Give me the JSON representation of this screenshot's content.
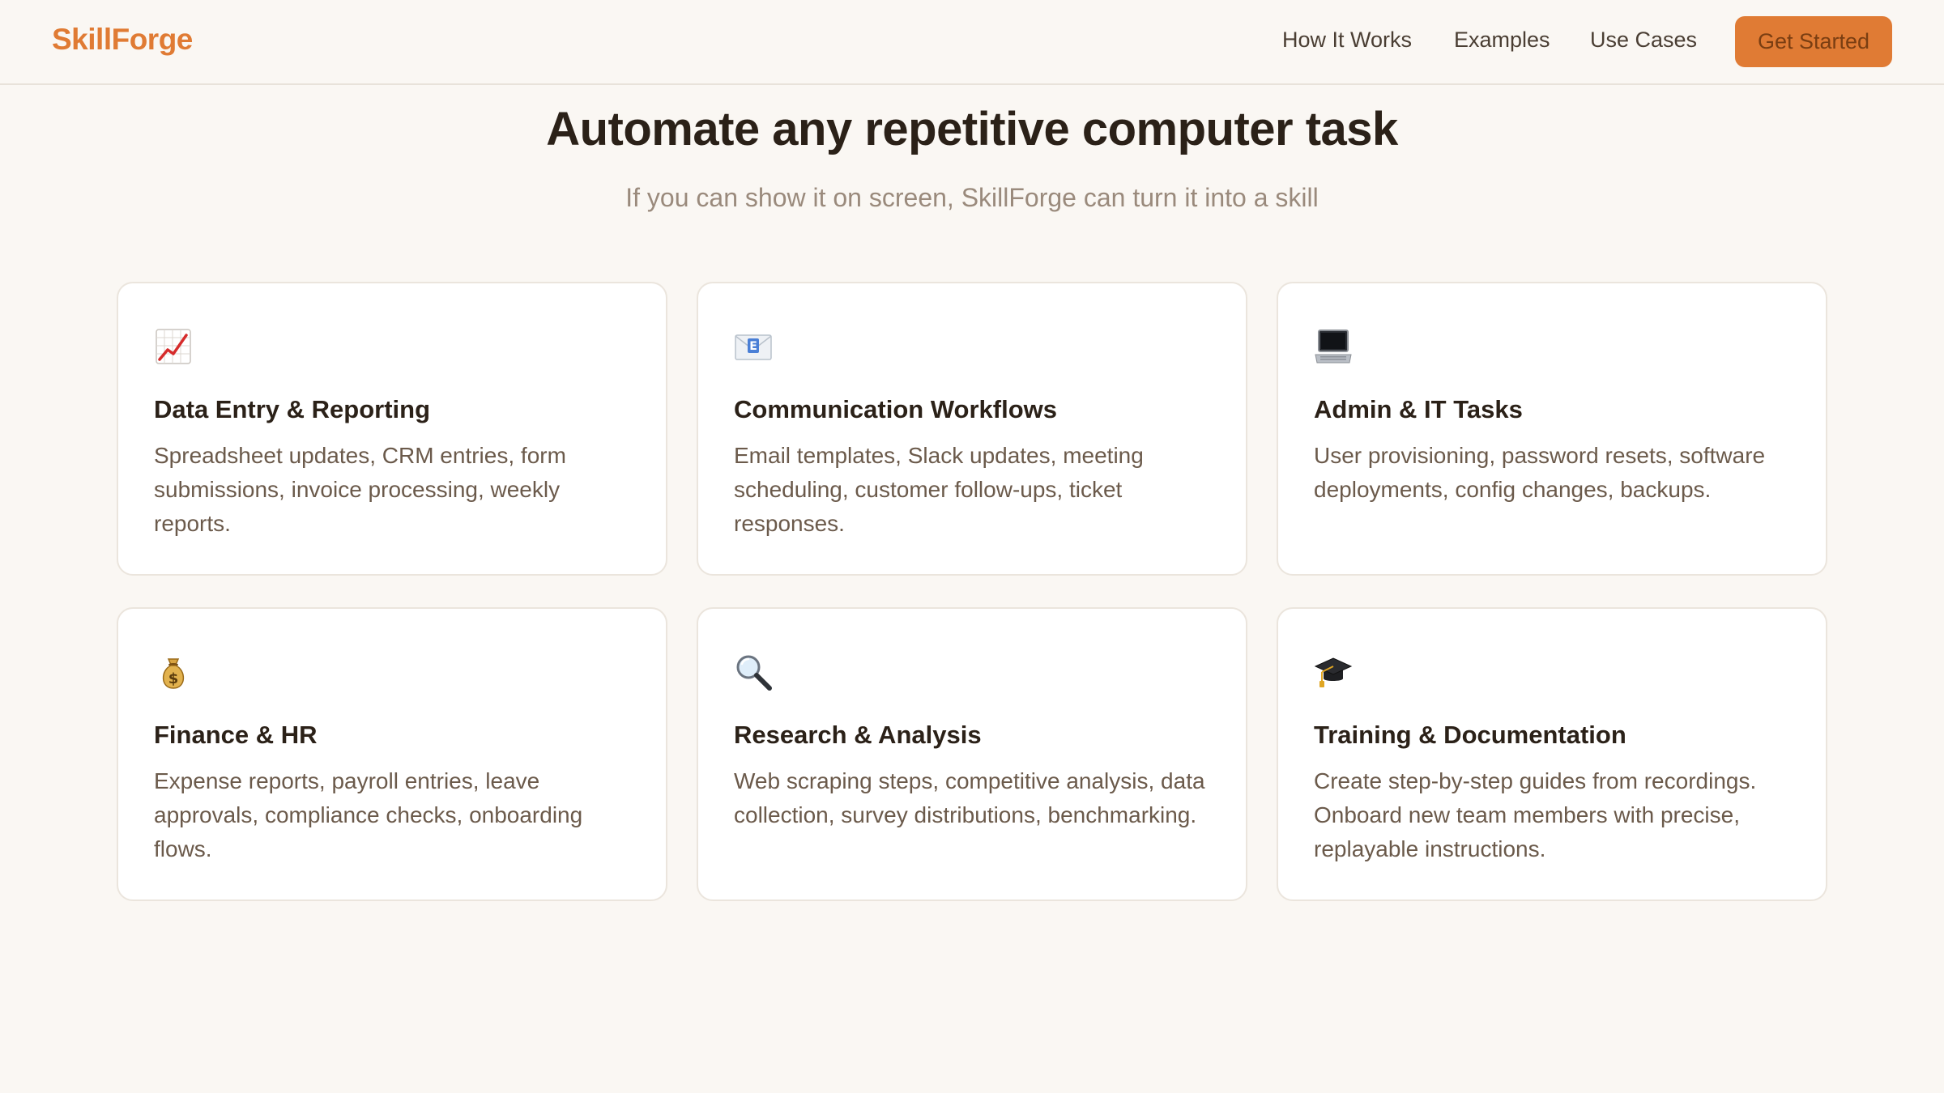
{
  "brand": "SkillForge",
  "nav": {
    "how": "How It Works",
    "examples": "Examples",
    "use_cases": "Use Cases",
    "cta": "Get Started"
  },
  "hero": {
    "title": "Automate any repetitive computer task",
    "subtitle": "If you can show it on screen, SkillForge can turn it into a skill"
  },
  "colors": {
    "accent": "#e07b34",
    "background": "#faf7f3",
    "card": "#ffffff",
    "text_primary": "#2b2118",
    "text_secondary": "#6b5a4b"
  },
  "cards": [
    {
      "icon": "chart-increasing-icon",
      "title": "Data Entry & Reporting",
      "desc": "Spreadsheet updates, CRM entries, form submissions, invoice processing, weekly reports."
    },
    {
      "icon": "email-envelope-icon",
      "title": "Communication Workflows",
      "desc": "Email templates, Slack updates, meeting scheduling, customer follow-ups, ticket responses."
    },
    {
      "icon": "laptop-icon",
      "title": "Admin & IT Tasks",
      "desc": "User provisioning, password resets, software deployments, config changes, backups."
    },
    {
      "icon": "money-bag-icon",
      "title": "Finance & HR",
      "desc": "Expense reports, payroll entries, leave approvals, compliance checks, onboarding flows."
    },
    {
      "icon": "magnifying-glass-icon",
      "title": "Research & Analysis",
      "desc": "Web scraping steps, competitive analysis, data collection, survey distributions, benchmarking."
    },
    {
      "icon": "graduation-cap-icon",
      "title": "Training & Documentation",
      "desc": "Create step-by-step guides from recordings. Onboard new team members with precise, replayable instructions."
    }
  ]
}
